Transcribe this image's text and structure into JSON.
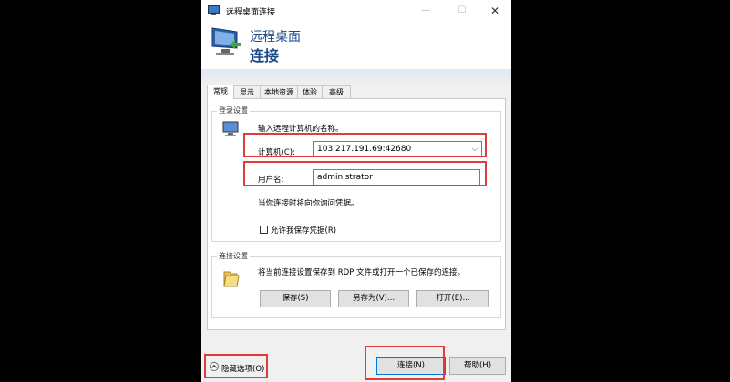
{
  "window": {
    "title": "远程桌面连接",
    "min": "—",
    "max": "☐",
    "close": "✕"
  },
  "banner": {
    "line1": "远程桌面",
    "line2": "连接"
  },
  "tabs": [
    "常规",
    "显示",
    "本地资源",
    "体验",
    "高级"
  ],
  "login": {
    "group_title": "登录设置",
    "prompt": "输入远程计算机的名称。",
    "computer_label": "计算机(C):",
    "computer_value": "103.217.191.69:42680",
    "username_label": "用户名:",
    "username_value": "administrator",
    "note": "当你连接时将向你询问凭据。",
    "save_cred_label": "允许我保存凭据(R)"
  },
  "conn": {
    "group_title": "连接设置",
    "desc": "将当前连接设置保存到 RDP 文件或打开一个已保存的连接。",
    "save": "保存(S)",
    "saveas": "另存为(V)...",
    "open": "打开(E)..."
  },
  "footer": {
    "hide_options": "隐藏选项(O)",
    "connect": "连接(N)",
    "help": "帮助(H)"
  },
  "colors": {
    "highlight": "#e03c3c",
    "banner_text": "#1c4b8c"
  }
}
